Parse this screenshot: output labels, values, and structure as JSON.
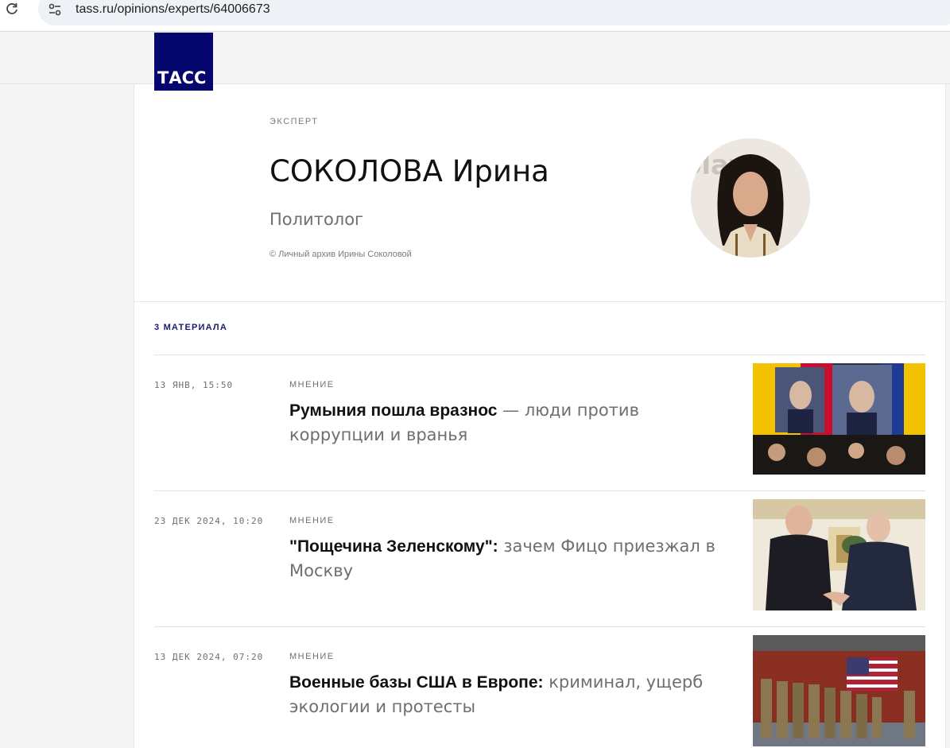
{
  "browser": {
    "url": "tass.ru/opinions/experts/64006673"
  },
  "site": {
    "logo_text": "ТАСС"
  },
  "expert": {
    "label": "ЭКСПЕРТ",
    "name": "СОКОЛОВА Ирина",
    "role": "Политолог",
    "photo_credit": "© Личный архив Ирины Соколовой"
  },
  "materials": {
    "count_label": "3 МАТЕРИАЛА",
    "items": [
      {
        "date": "13 ЯНВ, 15:50",
        "kind": "МНЕНИЕ",
        "title_lead": "Румыния пошла вразнос",
        "title_rest": "— люди против коррупции и вранья"
      },
      {
        "date": "23 ДЕК 2024, 10:20",
        "kind": "МНЕНИЕ",
        "title_lead": "\"Пощечина Зеленскому\":",
        "title_rest": "зачем Фицо приезжал в Москву"
      },
      {
        "date": "13 ДЕК 2024, 07:20",
        "kind": "МНЕНИЕ",
        "title_lead": "Военные базы США в Европе:",
        "title_rest": "криминал, ущерб экологии и протесты"
      }
    ]
  },
  "colors": {
    "brand": "#06066f",
    "text": "#111111",
    "muted": "#6e6e73"
  }
}
